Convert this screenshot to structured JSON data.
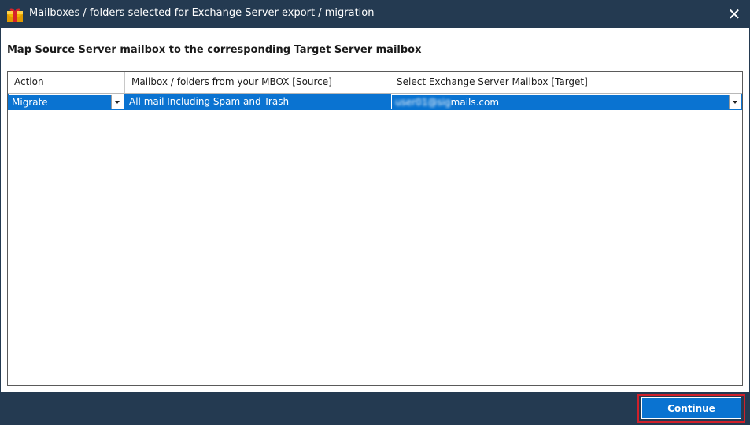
{
  "window": {
    "title": "Mailboxes / folders selected for Exchange Server export / migration",
    "close_glyph": "✕",
    "app_icon": "mail-gift-icon",
    "close_icon": "close-icon",
    "background_color": "#243a51"
  },
  "heading": "Map Source Server mailbox to the corresponding Target Server mailbox",
  "grid": {
    "columns": [
      "Action",
      "Mailbox / folders from your MBOX [Source]",
      "Select Exchange Server Mailbox [Target]"
    ],
    "rows": [
      {
        "action": "Migrate",
        "source": "All mail Including Spam and Trash",
        "target_blurred": "user01@sig",
        "target_visible": "mails.com",
        "selected": true
      }
    ],
    "selection_color": "#0a73d1"
  },
  "footer": {
    "continue_label": "Continue",
    "highlight_color": "#d0202a"
  }
}
